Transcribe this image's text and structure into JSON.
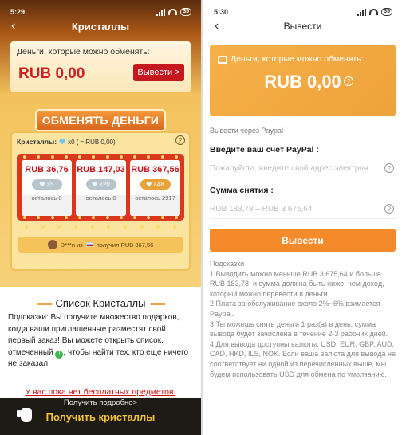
{
  "left": {
    "status": {
      "time": "5:29",
      "battery": "35"
    },
    "title": "Кристаллы",
    "money_label": "Деньги, которые можно обменять:",
    "money_value": "RUB 0,00",
    "withdraw_label": "Вывести >",
    "exchange_banner": "ОБМЕНЯТЬ ДЕНЬГИ",
    "crystals_label": "Кристаллы:",
    "crystals_value": "x0 ( ≈ RUB 0,00)",
    "offers": [
      {
        "price": "RUB 36,76",
        "cost": "×5",
        "left": "осталось 0"
      },
      {
        "price": "RUB 147,03",
        "cost": "×20",
        "left": "осталось 0"
      },
      {
        "price": "RUB 367,56",
        "cost": "×48",
        "left": "осталось 2917"
      }
    ],
    "winner": {
      "name": "D***n из",
      "prize": "получил RUB 367,56"
    },
    "list_title": "Список Кристаллы",
    "hint": "Подсказки: Вы получите множество подарков, когда ваши приглашенные разместят свой первый заказ! Вы можете открыть список, отмеченный",
    "hint_tail": ", чтобы найти тех, кто еще ничего не заказал.",
    "no_free": "У вас пока нет бесплатных предметов.",
    "details_link": "Получить подробно>",
    "get_crystals": "Получить кристаллы"
  },
  "right": {
    "status": {
      "time": "5:30",
      "battery": "35"
    },
    "title": "Вывести",
    "card_label": "Деньги, которые можно обменять:",
    "card_value": "RUB 0,00",
    "via": "Вывести через Paypal",
    "account_label": "Введите ваш счет PayPal :",
    "account_placeholder": "Пожалуйста, введите свой адрес электрон",
    "amount_label": "Сумма снятия :",
    "amount_placeholder": "RUB 183,78 – RUB 3 675,64",
    "withdraw_button": "Вывести",
    "tips_title": "Подсказки",
    "tips": [
      "1.Выводить можно меньше RUB 3 675,64 и больше RUB 183,78, и сумма должна быть ниже, чем доход, который можно перевести в деньги",
      "2.Плата за обслуживание около 2%~6% взимается Paypal.",
      "3.Ты можешь снять деньги 1 раз(а) в день, сумма вывода будет зачислена в течение 2-3 рабочих дней.",
      "4.Для вывода доступны валюты: USD, EUR, GBP, AUD, CAD, HKD, ILS, NOK. Если ваша валюта для вывода не соответствует ни одной из перечисленных выше, мы будем использовать USD для обмена по умолчанию."
    ]
  },
  "colors": {
    "accent_red": "#c5181e",
    "accent_orange": "#f58a2a",
    "gold": "#f3c23a"
  }
}
